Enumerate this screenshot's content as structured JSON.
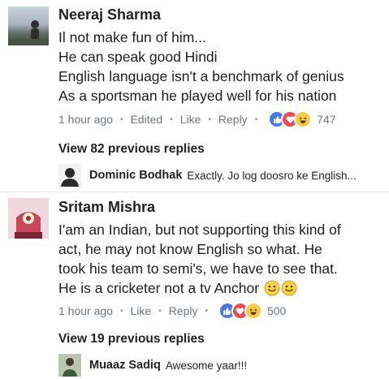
{
  "comments": [
    {
      "author": "Neeraj Sharma",
      "lines": [
        "Il not make fun of him...",
        "He can speak good Hindi",
        "English language isn't a benchmark of genius",
        "As a sportsman he played well for his nation"
      ],
      "time": "1 hour ago",
      "edited": "Edited",
      "like": "Like",
      "reply": "Reply",
      "reaction_count": "747",
      "view_replies": "View 82 previous replies",
      "latest_reply": {
        "author": "Dominic Bodhak",
        "text": "Exactly. Jo log doosro ke English..."
      }
    },
    {
      "author": "Sritam Mishra",
      "lines": [
        "I'am an Indian, but not supporting this kind of",
        "act, he may not know English so what. He",
        "took his team to semi's, we have to see that.",
        "He is a cricketer not a tv Anchor"
      ],
      "time": "1 hour ago",
      "like": "Like",
      "reply": "Reply",
      "reaction_count": "500",
      "view_replies": "View 19 previous replies",
      "latest_reply": {
        "author": "Muaaz Sadiq",
        "text": "Awesome yaar!!!"
      }
    }
  ],
  "colors": {
    "like": "#4a78e6",
    "love": "#f0494e",
    "haha": "#f6cb47",
    "meta_text": "#6e7681"
  }
}
